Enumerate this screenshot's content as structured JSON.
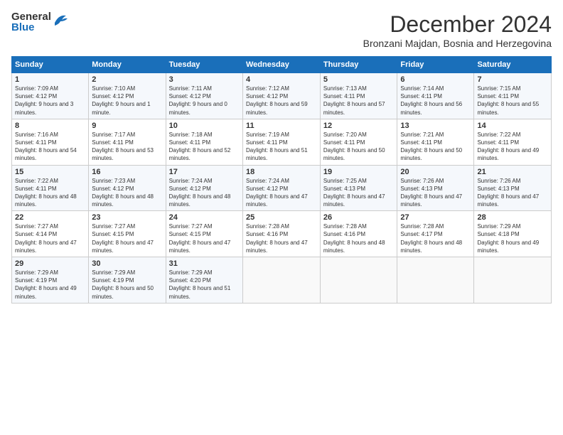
{
  "header": {
    "logo_general": "General",
    "logo_blue": "Blue",
    "month_title": "December 2024",
    "subtitle": "Bronzani Majdan, Bosnia and Herzegovina"
  },
  "days_of_week": [
    "Sunday",
    "Monday",
    "Tuesday",
    "Wednesday",
    "Thursday",
    "Friday",
    "Saturday"
  ],
  "weeks": [
    [
      {
        "day": "1",
        "sunrise": "Sunrise: 7:09 AM",
        "sunset": "Sunset: 4:12 PM",
        "daylight": "Daylight: 9 hours and 3 minutes."
      },
      {
        "day": "2",
        "sunrise": "Sunrise: 7:10 AM",
        "sunset": "Sunset: 4:12 PM",
        "daylight": "Daylight: 9 hours and 1 minute."
      },
      {
        "day": "3",
        "sunrise": "Sunrise: 7:11 AM",
        "sunset": "Sunset: 4:12 PM",
        "daylight": "Daylight: 9 hours and 0 minutes."
      },
      {
        "day": "4",
        "sunrise": "Sunrise: 7:12 AM",
        "sunset": "Sunset: 4:12 PM",
        "daylight": "Daylight: 8 hours and 59 minutes."
      },
      {
        "day": "5",
        "sunrise": "Sunrise: 7:13 AM",
        "sunset": "Sunset: 4:11 PM",
        "daylight": "Daylight: 8 hours and 57 minutes."
      },
      {
        "day": "6",
        "sunrise": "Sunrise: 7:14 AM",
        "sunset": "Sunset: 4:11 PM",
        "daylight": "Daylight: 8 hours and 56 minutes."
      },
      {
        "day": "7",
        "sunrise": "Sunrise: 7:15 AM",
        "sunset": "Sunset: 4:11 PM",
        "daylight": "Daylight: 8 hours and 55 minutes."
      }
    ],
    [
      {
        "day": "8",
        "sunrise": "Sunrise: 7:16 AM",
        "sunset": "Sunset: 4:11 PM",
        "daylight": "Daylight: 8 hours and 54 minutes."
      },
      {
        "day": "9",
        "sunrise": "Sunrise: 7:17 AM",
        "sunset": "Sunset: 4:11 PM",
        "daylight": "Daylight: 8 hours and 53 minutes."
      },
      {
        "day": "10",
        "sunrise": "Sunrise: 7:18 AM",
        "sunset": "Sunset: 4:11 PM",
        "daylight": "Daylight: 8 hours and 52 minutes."
      },
      {
        "day": "11",
        "sunrise": "Sunrise: 7:19 AM",
        "sunset": "Sunset: 4:11 PM",
        "daylight": "Daylight: 8 hours and 51 minutes."
      },
      {
        "day": "12",
        "sunrise": "Sunrise: 7:20 AM",
        "sunset": "Sunset: 4:11 PM",
        "daylight": "Daylight: 8 hours and 50 minutes."
      },
      {
        "day": "13",
        "sunrise": "Sunrise: 7:21 AM",
        "sunset": "Sunset: 4:11 PM",
        "daylight": "Daylight: 8 hours and 50 minutes."
      },
      {
        "day": "14",
        "sunrise": "Sunrise: 7:22 AM",
        "sunset": "Sunset: 4:11 PM",
        "daylight": "Daylight: 8 hours and 49 minutes."
      }
    ],
    [
      {
        "day": "15",
        "sunrise": "Sunrise: 7:22 AM",
        "sunset": "Sunset: 4:11 PM",
        "daylight": "Daylight: 8 hours and 48 minutes."
      },
      {
        "day": "16",
        "sunrise": "Sunrise: 7:23 AM",
        "sunset": "Sunset: 4:12 PM",
        "daylight": "Daylight: 8 hours and 48 minutes."
      },
      {
        "day": "17",
        "sunrise": "Sunrise: 7:24 AM",
        "sunset": "Sunset: 4:12 PM",
        "daylight": "Daylight: 8 hours and 48 minutes."
      },
      {
        "day": "18",
        "sunrise": "Sunrise: 7:24 AM",
        "sunset": "Sunset: 4:12 PM",
        "daylight": "Daylight: 8 hours and 47 minutes."
      },
      {
        "day": "19",
        "sunrise": "Sunrise: 7:25 AM",
        "sunset": "Sunset: 4:13 PM",
        "daylight": "Daylight: 8 hours and 47 minutes."
      },
      {
        "day": "20",
        "sunrise": "Sunrise: 7:26 AM",
        "sunset": "Sunset: 4:13 PM",
        "daylight": "Daylight: 8 hours and 47 minutes."
      },
      {
        "day": "21",
        "sunrise": "Sunrise: 7:26 AM",
        "sunset": "Sunset: 4:13 PM",
        "daylight": "Daylight: 8 hours and 47 minutes."
      }
    ],
    [
      {
        "day": "22",
        "sunrise": "Sunrise: 7:27 AM",
        "sunset": "Sunset: 4:14 PM",
        "daylight": "Daylight: 8 hours and 47 minutes."
      },
      {
        "day": "23",
        "sunrise": "Sunrise: 7:27 AM",
        "sunset": "Sunset: 4:15 PM",
        "daylight": "Daylight: 8 hours and 47 minutes."
      },
      {
        "day": "24",
        "sunrise": "Sunrise: 7:27 AM",
        "sunset": "Sunset: 4:15 PM",
        "daylight": "Daylight: 8 hours and 47 minutes."
      },
      {
        "day": "25",
        "sunrise": "Sunrise: 7:28 AM",
        "sunset": "Sunset: 4:16 PM",
        "daylight": "Daylight: 8 hours and 47 minutes."
      },
      {
        "day": "26",
        "sunrise": "Sunrise: 7:28 AM",
        "sunset": "Sunset: 4:16 PM",
        "daylight": "Daylight: 8 hours and 48 minutes."
      },
      {
        "day": "27",
        "sunrise": "Sunrise: 7:28 AM",
        "sunset": "Sunset: 4:17 PM",
        "daylight": "Daylight: 8 hours and 48 minutes."
      },
      {
        "day": "28",
        "sunrise": "Sunrise: 7:29 AM",
        "sunset": "Sunset: 4:18 PM",
        "daylight": "Daylight: 8 hours and 49 minutes."
      }
    ],
    [
      {
        "day": "29",
        "sunrise": "Sunrise: 7:29 AM",
        "sunset": "Sunset: 4:19 PM",
        "daylight": "Daylight: 8 hours and 49 minutes."
      },
      {
        "day": "30",
        "sunrise": "Sunrise: 7:29 AM",
        "sunset": "Sunset: 4:19 PM",
        "daylight": "Daylight: 8 hours and 50 minutes."
      },
      {
        "day": "31",
        "sunrise": "Sunrise: 7:29 AM",
        "sunset": "Sunset: 4:20 PM",
        "daylight": "Daylight: 8 hours and 51 minutes."
      },
      {
        "day": "",
        "sunrise": "",
        "sunset": "",
        "daylight": ""
      },
      {
        "day": "",
        "sunrise": "",
        "sunset": "",
        "daylight": ""
      },
      {
        "day": "",
        "sunrise": "",
        "sunset": "",
        "daylight": ""
      },
      {
        "day": "",
        "sunrise": "",
        "sunset": "",
        "daylight": ""
      }
    ]
  ]
}
